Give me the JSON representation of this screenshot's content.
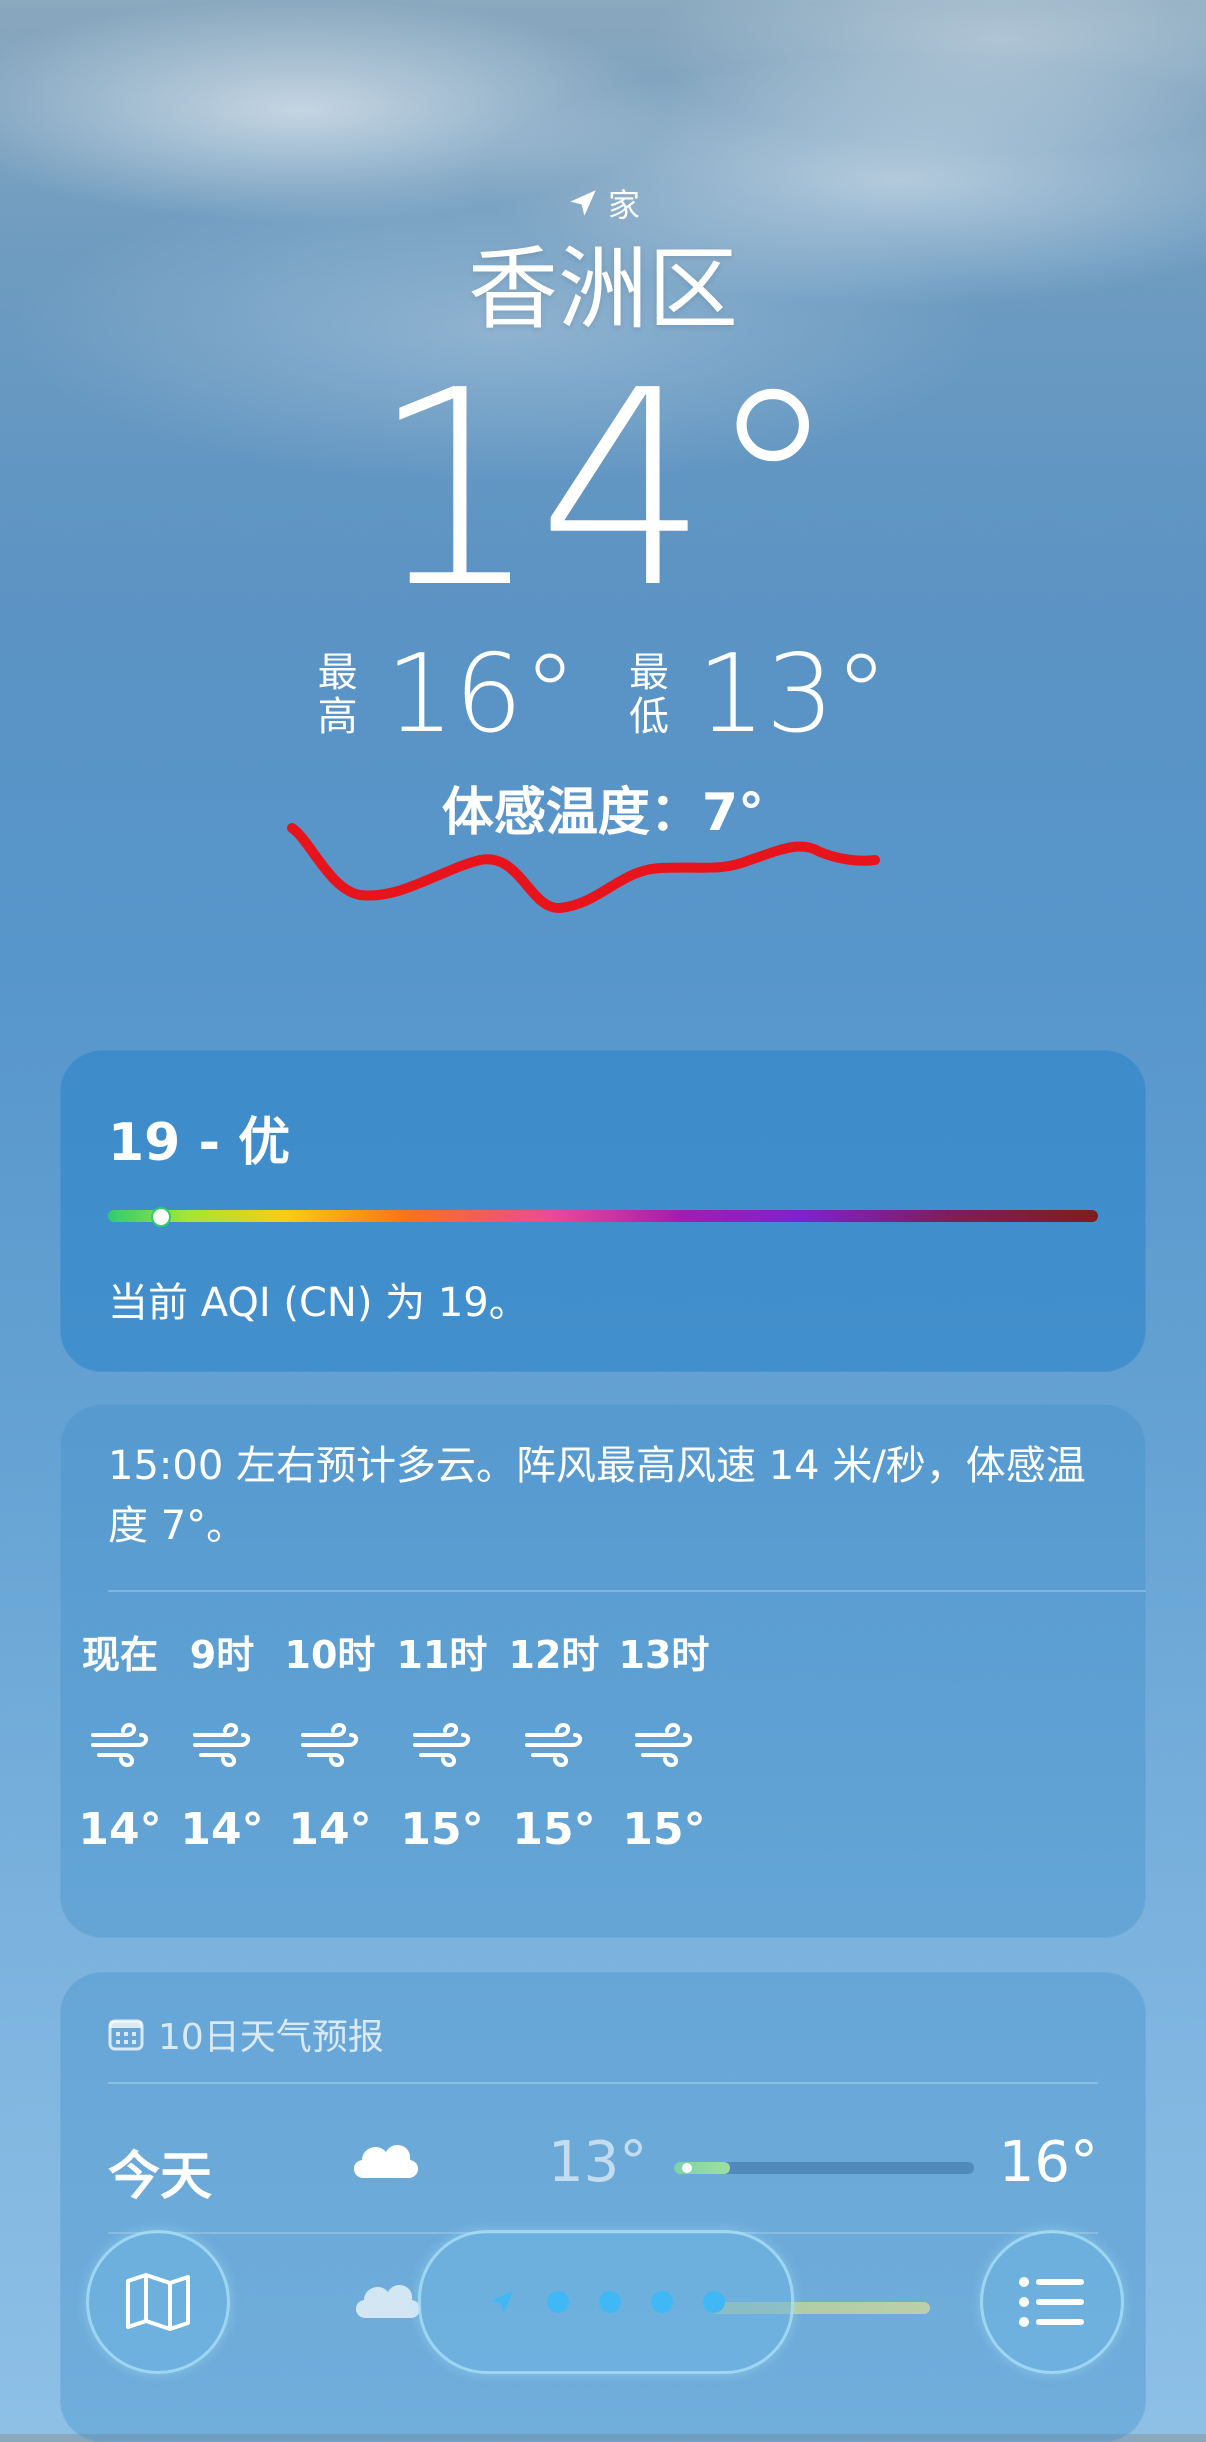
{
  "location": {
    "home_label": "家",
    "city": "香洲区"
  },
  "current": {
    "temperature": "14°",
    "high_label": [
      "最",
      "高"
    ],
    "high": "16°",
    "low_label": [
      "最",
      "低"
    ],
    "low": "13°",
    "feels_like": "体感温度：7°"
  },
  "aqi": {
    "title": "19 - 优",
    "value": 19,
    "description": "当前 AQI (CN) 为 19。",
    "colors": [
      "#2ecc71",
      "#a3e635",
      "#facc15",
      "#f97316",
      "#ec4899",
      "#a21caf",
      "#7e22ce",
      "#7f1d1d"
    ]
  },
  "hourly": {
    "summary": "15:00 左右预计多云。阵风最高风速 14 米/秒，体感温度 7°。",
    "hours": [
      {
        "label": "现在",
        "icon": "wind-icon",
        "temp": "14°"
      },
      {
        "label": "9时",
        "icon": "wind-icon",
        "temp": "14°"
      },
      {
        "label": "10时",
        "icon": "wind-icon",
        "temp": "14°"
      },
      {
        "label": "11时",
        "icon": "wind-icon",
        "temp": "15°"
      },
      {
        "label": "12时",
        "icon": "wind-icon",
        "temp": "15°"
      },
      {
        "label": "13时",
        "icon": "wind-icon",
        "temp": "15°"
      }
    ]
  },
  "ten_day": {
    "title": "10日天气预报",
    "icon": "calendar-icon",
    "rows": [
      {
        "day": "今天",
        "icon": "cloud-icon",
        "low": "13°",
        "high": "16°"
      }
    ]
  },
  "toolbar": {
    "map_icon": "map-icon",
    "location_icon": "location-arrow-icon",
    "page_count": 4,
    "list_icon": "list-icon"
  },
  "colors": {
    "annotation": "#e8141c",
    "page_dot": "#40b8f5"
  }
}
